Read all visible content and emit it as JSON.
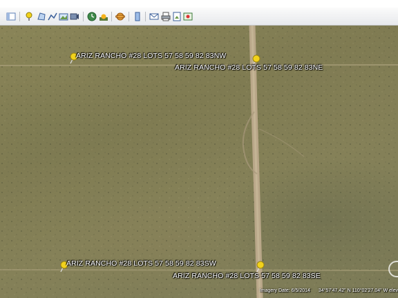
{
  "toolbar": {
    "icons": [
      "sidebar-toggle-icon",
      "placemark-icon",
      "polygon-icon",
      "path-icon",
      "image-overlay-icon",
      "record-tour-icon",
      "historical-imagery-icon",
      "sunlight-icon",
      "planets-icon",
      "ruler-icon",
      "email-icon",
      "print-icon",
      "save-image-icon",
      "maps-icon"
    ]
  },
  "placemarks": [
    {
      "label": "ARIZ RANCHO #28 LOTS 57 58 59 82 83NW"
    },
    {
      "label": "ARIZ RANCHO #28 LOTS 57 58 59 82 83NE"
    },
    {
      "label": "ARIZ RANCHO #28 LOTS 57 58 59 82 83SW"
    },
    {
      "label": "ARIZ RANCHO #28 LOTS 57 58 59 82 83SE"
    }
  ],
  "status": {
    "imagery_date": "Imagery Date: 6/5/2014",
    "coordinates": "34°57'47.42\" N  110°02'27.04\" W  elev"
  },
  "colors": {
    "pin": "#f2d21b",
    "road": "#b9a789",
    "terrain": "#837f55"
  }
}
